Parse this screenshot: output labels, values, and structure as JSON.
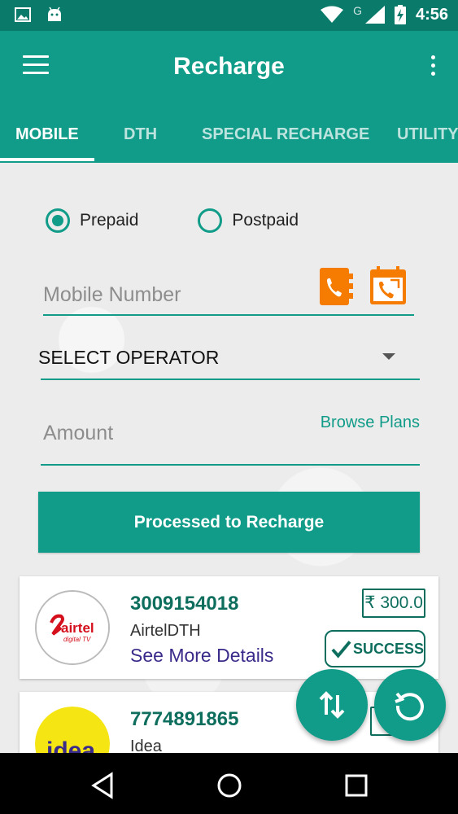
{
  "status_bar": {
    "network_label": "G",
    "time": "4:56",
    "icons": [
      "image-icon",
      "android-icon",
      "wifi-icon",
      "signal-icon",
      "battery-charging-icon"
    ]
  },
  "app_bar": {
    "title": "Recharge",
    "icons": [
      "menu-icon",
      "more-vert-icon"
    ]
  },
  "tabs": [
    {
      "label": "MOBILE",
      "active": true
    },
    {
      "label": "DTH",
      "active": false
    },
    {
      "label": "SPECIAL RECHARGE",
      "active": false
    },
    {
      "label": "UTILITY",
      "active": false
    }
  ],
  "form": {
    "plan_types": [
      {
        "label": "Prepaid",
        "checked": true
      },
      {
        "label": "Postpaid",
        "checked": false
      }
    ],
    "mobile_number_placeholder": "Mobile Number",
    "mobile_number_value": "",
    "operator_selected": "SELECT OPERATOR",
    "amount_placeholder": "Amount",
    "amount_value": "",
    "browse_plans_label": "Browse Plans",
    "submit_label": "Processed to Recharge"
  },
  "history": [
    {
      "number": "3009154018",
      "operator": "AirtelDTH",
      "details_label": "See More Details",
      "amount": "₹ 300.0",
      "status": "SUCCESS",
      "logo": "airtel-digital-tv-logo"
    },
    {
      "number": "7774891865",
      "operator": "Idea",
      "logo": "idea-logo"
    }
  ],
  "fabs": [
    "swap-vertical-icon",
    "refresh-icon"
  ],
  "navigation": [
    "back-icon",
    "home-icon",
    "recents-icon"
  ],
  "colors": {
    "primary": "#109c88",
    "primary_dark": "#0a7b6b",
    "accent_icon": "#f57c00",
    "number_text": "#0e6e5e",
    "details_link": "#3a2a8a"
  }
}
